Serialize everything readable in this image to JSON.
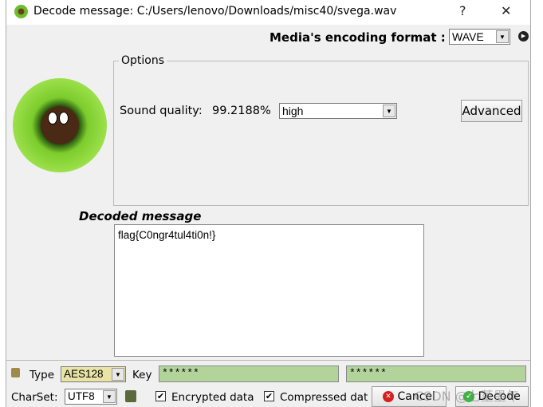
{
  "window": {
    "title": "Decode message: C:/Users/lenovo/Downloads/misc40/svega.wav",
    "help": "?",
    "close": "✕"
  },
  "format": {
    "label": "Media's encoding format :",
    "value": "WAVE"
  },
  "options": {
    "legend": "Options",
    "sound_quality_label": "Sound quality:",
    "sound_quality_value": "99.2188%",
    "quality_select": "high",
    "advanced": "Advanced"
  },
  "decoded": {
    "label": "Decoded message",
    "text": "flag{C0ngr4tul4ti0n!}"
  },
  "bottom": {
    "type_label": "Type",
    "type_value": "AES128",
    "key_label": "Key",
    "key1": "******",
    "key2": "******",
    "charset_label": "CharSet:",
    "charset_value": "UTF8",
    "encrypted_label": "Encrypted data",
    "encrypted_checked": true,
    "compressed_label": "Compressed dat",
    "compressed_checked": true,
    "cancel": "Cancel",
    "decode": "Decode"
  },
  "watermark": "CSDN @七堇墨年"
}
